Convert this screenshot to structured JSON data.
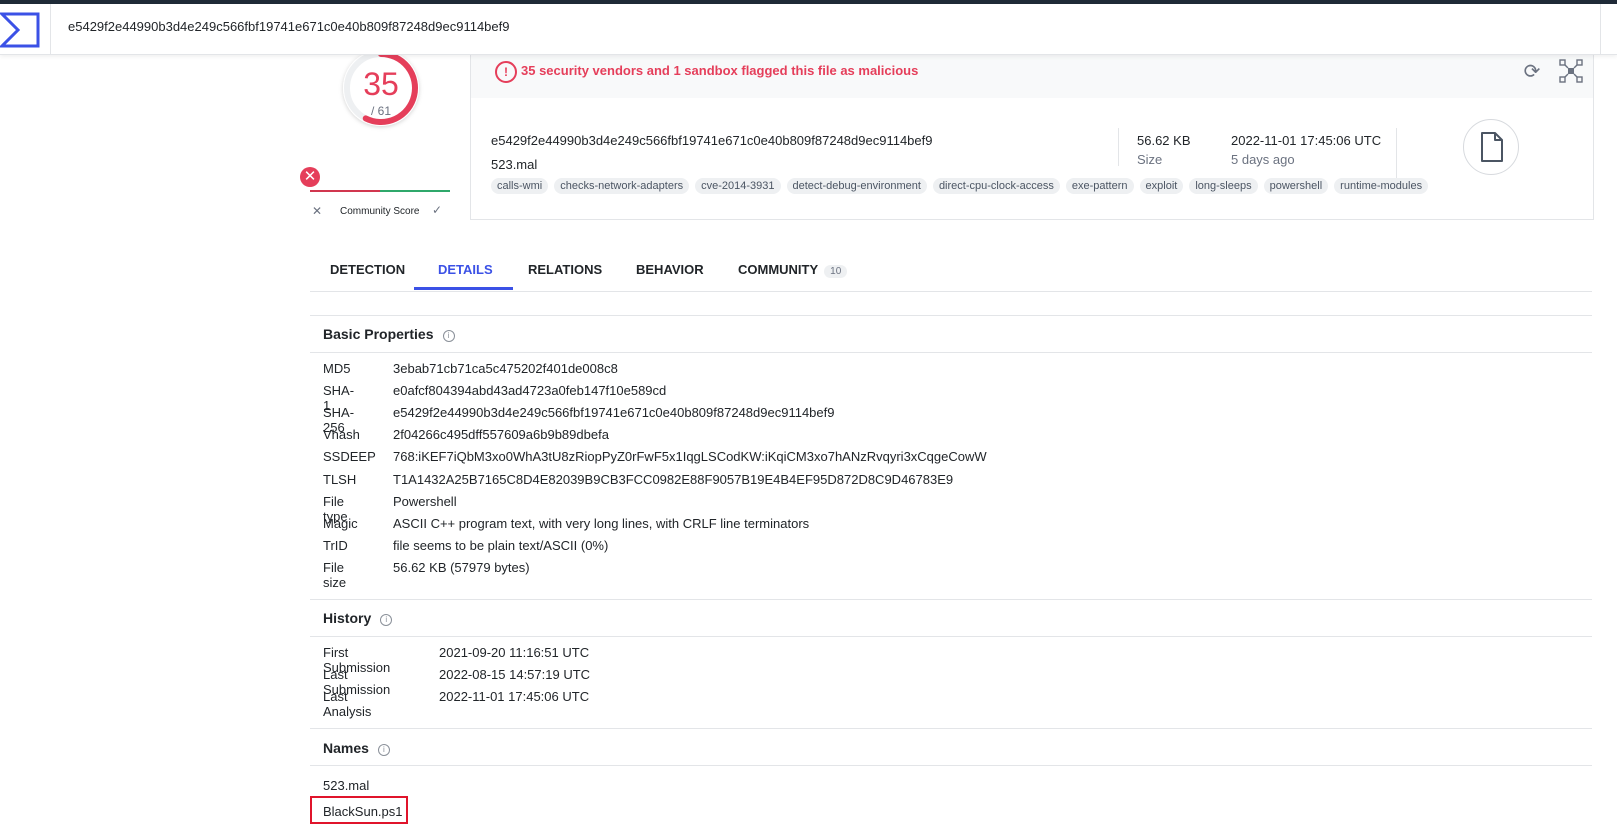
{
  "header": {
    "search_value": "e5429f2e44990b3d4e249c566fbf19741e671c0e40b809f87248d9ec9114bef9"
  },
  "score": {
    "detections": "35",
    "total": "/ 61",
    "ratio": 0.574,
    "color": "#e53e5a"
  },
  "community": {
    "label": "Community Score"
  },
  "alert": {
    "text": "35 security vendors and 1 sandbox flagged this file as malicious"
  },
  "file": {
    "hash": "e5429f2e44990b3d4e249c566fbf19741e671c0e40b809f87248d9ec9114bef9",
    "name": "523.mal",
    "size_value": "56.62 KB",
    "size_label": "Size",
    "date": "2022-11-01 17:45:06 UTC",
    "date_ago": "5 days ago",
    "tags": [
      "calls-wmi",
      "checks-network-adapters",
      "cve-2014-3931",
      "detect-debug-environment",
      "direct-cpu-clock-access",
      "exe-pattern",
      "exploit",
      "long-sleeps",
      "powershell",
      "runtime-modules"
    ]
  },
  "tabs": [
    {
      "label": "DETECTION"
    },
    {
      "label": "DETAILS"
    },
    {
      "label": "RELATIONS"
    },
    {
      "label": "BEHAVIOR"
    },
    {
      "label": "COMMUNITY",
      "count": "10"
    }
  ],
  "basic": {
    "title": "Basic Properties",
    "rows": [
      {
        "key": "MD5",
        "value": "3ebab71cb71ca5c475202f401de008c8"
      },
      {
        "key": "SHA-1",
        "value": "e0afcf804394abd43ad4723a0feb147f10e589cd"
      },
      {
        "key": "SHA-256",
        "value": "e5429f2e44990b3d4e249c566fbf19741e671c0e40b809f87248d9ec9114bef9"
      },
      {
        "key": "Vhash",
        "value": "2f04266c495dff557609a6b9b89dbefa"
      },
      {
        "key": "SSDEEP",
        "value": "768:iKEF7iQbM3xo0WhA3tU8zRiopPyZ0rFwF5x1IqgLSCodKW:iKqiCM3xo7hANzRvqyri3xCqgeCowW"
      },
      {
        "key": "TLSH",
        "value": "T1A1432A25B7165C8D4E82039B9CB3FCC0982E88F9057B19E4B4EF95D872D8C9D46783E9"
      },
      {
        "key": "File type",
        "value": "Powershell"
      },
      {
        "key": "Magic",
        "value": "ASCII C++ program text, with very long lines, with CRLF line terminators"
      },
      {
        "key": "TrID",
        "value": "file seems to be plain text/ASCII (0%)"
      },
      {
        "key": "File size",
        "value": "56.62 KB (57979 bytes)"
      }
    ]
  },
  "history": {
    "title": "History",
    "rows": [
      {
        "key": "First Submission",
        "value": "2021-09-20 11:16:51 UTC"
      },
      {
        "key": "Last Submission",
        "value": "2022-08-15 14:57:19 UTC"
      },
      {
        "key": "Last Analysis",
        "value": "2022-11-01 17:45:06 UTC"
      }
    ]
  },
  "names": {
    "title": "Names",
    "items": [
      "523.mal",
      "BlackSun.ps1"
    ]
  }
}
